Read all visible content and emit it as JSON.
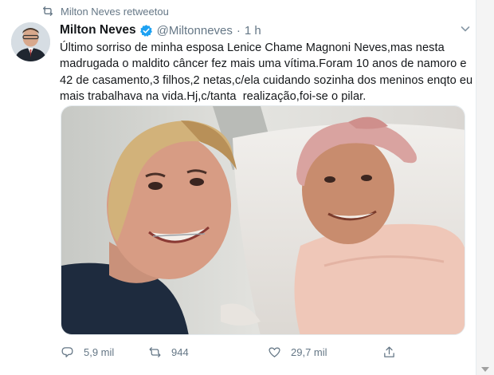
{
  "retweet_notice": "Milton Neves retweetou",
  "author": {
    "name": "Milton Neves",
    "handle": "@Miltonneves",
    "time": "1 h"
  },
  "tweet_text": "Último sorriso de minha esposa Lenice Chame Magnoni Neves,mas nesta madrugada o maldito câncer fez mais uma vítima.Foram 10 anos de namoro e 42 de casamento,3 filhos,2 netas,c/ela cuidando sozinha dos meninos enqto eu mais trabalhava na vida.Hj,c/tanta  realização,foi-se o pilar.",
  "actions": {
    "replies": "5,9 mil",
    "retweets": "944",
    "likes": "29,7 mil"
  },
  "colors": {
    "verified": "#1da1f2",
    "secondary_text": "#657786"
  }
}
